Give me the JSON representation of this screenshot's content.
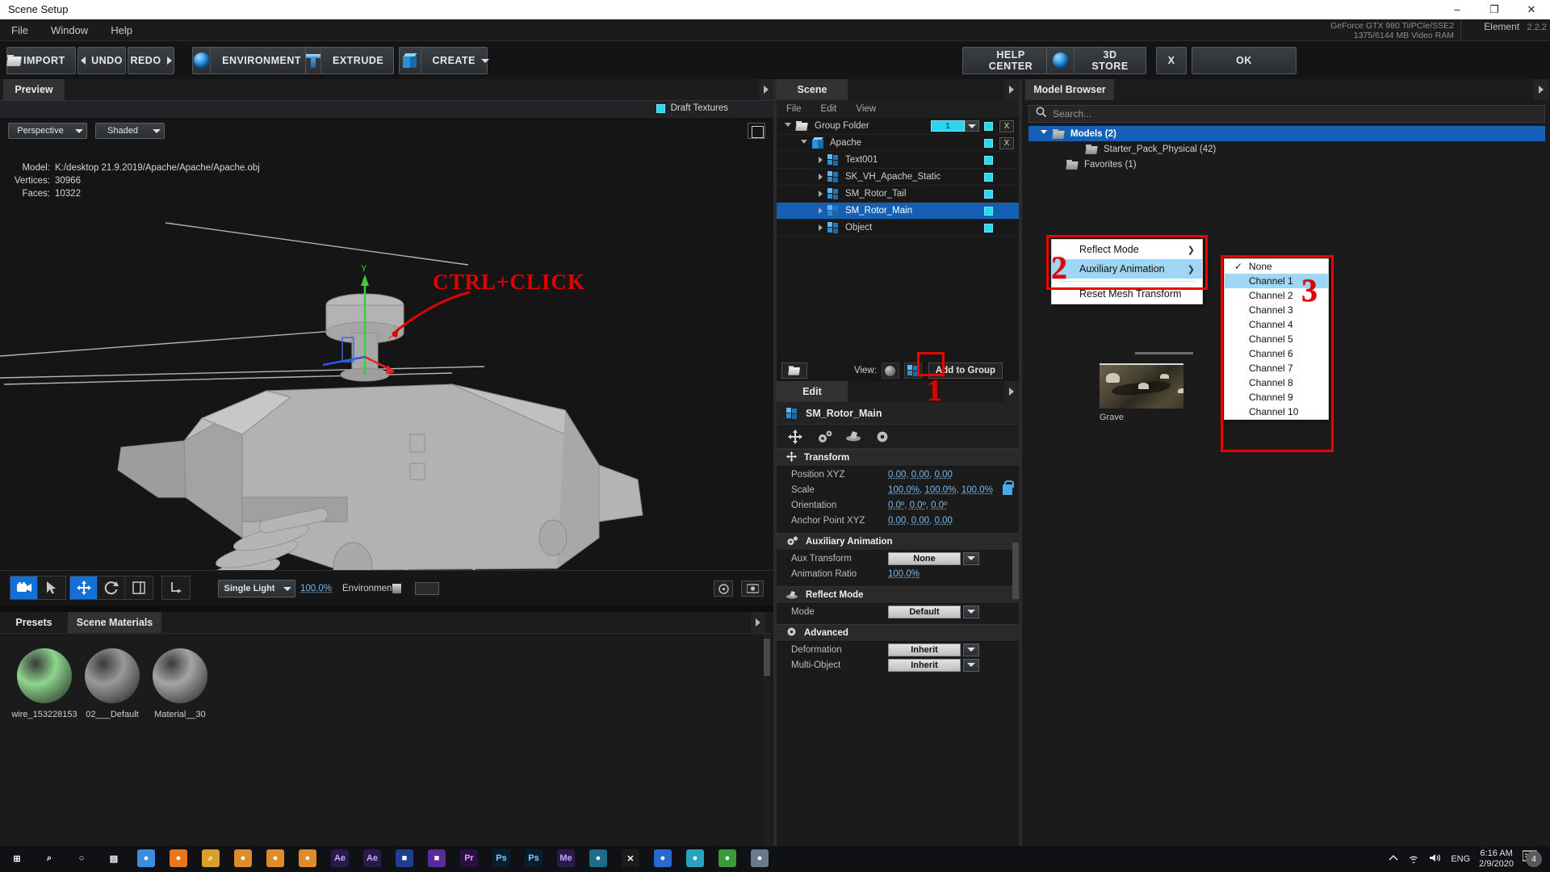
{
  "window": {
    "title": "Scene Setup",
    "minimize": "–",
    "restore": "❐",
    "close": "✕"
  },
  "menubar": {
    "items": [
      "File",
      "Window",
      "Help"
    ]
  },
  "gpu": {
    "line1": "GeForce GTX 980 Ti/PCIe/SSE2",
    "line2": "1375/6144 MB Video RAM"
  },
  "product": {
    "name": "Element",
    "version": "2.2.2"
  },
  "toolbar": {
    "import": "IMPORT",
    "undo": "UNDO",
    "redo": "REDO",
    "environment": "ENVIRONMENT",
    "extrude": "EXTRUDE",
    "create": "CREATE",
    "help_center": "HELP CENTER",
    "store": "3D STORE",
    "cancel": "X",
    "ok": "OK"
  },
  "preview": {
    "tab": "Preview",
    "draft_textures": "Draft Textures",
    "view_mode": "Perspective",
    "shading_mode": "Shaded",
    "info": {
      "model_key": "Model:",
      "model_value": "K:/desktop 21.9.2019/Apache/Apache/Apache.obj",
      "vertices_key": "Vertices:",
      "vertices_value": "30966",
      "faces_key": "Faces:",
      "faces_value": "10322"
    },
    "light_preset": "Single Light",
    "light_value": "100.0%",
    "environment_label": "Environment",
    "annotation": "CTRL+CLICK"
  },
  "materials": {
    "tabs": [
      {
        "label": "Presets",
        "active": false
      },
      {
        "label": "Scene Materials",
        "active": true
      }
    ],
    "items": [
      {
        "name": "wire_153228153",
        "color": "#8ed48e"
      },
      {
        "name": "02___Default",
        "color": "#9a9a9a"
      },
      {
        "name": "Material__30",
        "color": "#a5a5a5"
      }
    ]
  },
  "scene": {
    "tab": "Scene",
    "menu": [
      "File",
      "Edit",
      "View"
    ],
    "rows": [
      {
        "label": "Group Folder",
        "icon": "folder-icon",
        "indent": 10,
        "twirl": "open",
        "chip": "1",
        "has_chip": true,
        "visible": true,
        "xbtn": "X",
        "selected": false
      },
      {
        "label": "Apache",
        "icon": "cube-icon",
        "indent": 30,
        "twirl": "open",
        "has_chip": false,
        "visible": true,
        "xbtn": "X",
        "selected": false
      },
      {
        "label": "Text001",
        "icon": "mesh-icon",
        "indent": 52,
        "twirl": "closed",
        "has_chip": false,
        "visible": true,
        "xbtn": "",
        "selected": false
      },
      {
        "label": "SK_VH_Apache_Static",
        "icon": "mesh-icon",
        "indent": 52,
        "twirl": "closed",
        "has_chip": false,
        "visible": true,
        "xbtn": "",
        "selected": false
      },
      {
        "label": "SM_Rotor_Tail",
        "icon": "mesh-icon",
        "indent": 52,
        "twirl": "closed",
        "has_chip": false,
        "visible": true,
        "xbtn": "",
        "selected": false
      },
      {
        "label": "SM_Rotor_Main",
        "icon": "mesh-icon",
        "indent": 52,
        "twirl": "closed",
        "has_chip": false,
        "visible": true,
        "xbtn": "",
        "selected": true
      },
      {
        "label": "Object",
        "icon": "mesh-icon",
        "indent": 52,
        "twirl": "closed",
        "has_chip": false,
        "visible": true,
        "xbtn": "",
        "selected": false
      }
    ],
    "view_label": "View:",
    "add_to_group": "Add to Group"
  },
  "context_menu": {
    "items": [
      {
        "label": "Reflect Mode",
        "submenu": true,
        "highlighted": false
      },
      {
        "label": "Auxiliary Animation",
        "submenu": true,
        "highlighted": true
      },
      {
        "label": "Reset Mesh Transform",
        "submenu": false,
        "highlighted": false
      }
    ],
    "marker": "2"
  },
  "channel_menu": {
    "items": [
      {
        "label": "None",
        "checked": true,
        "highlighted": false
      },
      {
        "label": "Channel 1",
        "checked": false,
        "highlighted": true
      },
      {
        "label": "Channel 2",
        "checked": false,
        "highlighted": false
      },
      {
        "label": "Channel 3",
        "checked": false,
        "highlighted": false
      },
      {
        "label": "Channel 4",
        "checked": false,
        "highlighted": false
      },
      {
        "label": "Channel 5",
        "checked": false,
        "highlighted": false
      },
      {
        "label": "Channel 6",
        "checked": false,
        "highlighted": false
      },
      {
        "label": "Channel 7",
        "checked": false,
        "highlighted": false
      },
      {
        "label": "Channel 8",
        "checked": false,
        "highlighted": false
      },
      {
        "label": "Channel 9",
        "checked": false,
        "highlighted": false
      },
      {
        "label": "Channel 10",
        "checked": false,
        "highlighted": false
      }
    ],
    "marker": "3"
  },
  "markers": {
    "one": "1"
  },
  "edit": {
    "tab": "Edit",
    "object_name": "SM_Rotor_Main",
    "sections": [
      {
        "title": "Transform",
        "icon": "move-icon",
        "rows": [
          {
            "label": "Position XYZ",
            "type": "numbers",
            "values": [
              "0.00",
              "0.00",
              "0.00"
            ]
          },
          {
            "label": "Scale",
            "type": "numbers",
            "values": [
              "100.0%",
              "100.0%",
              "100.0%"
            ],
            "lock": true
          },
          {
            "label": "Orientation",
            "type": "numbers",
            "values": [
              "0.0º",
              "0.0º",
              "0.0º"
            ]
          },
          {
            "label": "Anchor Point XYZ",
            "type": "numbers",
            "values": [
              "0.00",
              "0.00",
              "0.00"
            ]
          }
        ]
      },
      {
        "title": "Auxiliary Animation",
        "icon": "gears-icon",
        "rows": [
          {
            "label": "Aux Transform",
            "type": "combo",
            "value": "None"
          },
          {
            "label": "Animation Ratio",
            "type": "numbers",
            "values": [
              "100.0%"
            ]
          }
        ]
      },
      {
        "title": "Reflect Mode",
        "icon": "reflect-icon",
        "rows": [
          {
            "label": "Mode",
            "type": "combo",
            "value": "Default"
          }
        ]
      },
      {
        "title": "Advanced",
        "icon": "gear-icon",
        "rows": [
          {
            "label": "Deformation",
            "type": "combo",
            "value": "Inherit"
          },
          {
            "label": "Multi-Object",
            "type": "combo",
            "value": "Inherit"
          }
        ]
      }
    ]
  },
  "model_browser": {
    "tab": "Model Browser",
    "search_placeholder": "Search...",
    "rows": [
      {
        "label": "Models (2)",
        "indent": 8,
        "twirl": "open",
        "selected": true
      },
      {
        "label": "Starter_Pack_Physical (42)",
        "indent": 48,
        "twirl": "none",
        "selected": false
      },
      {
        "label": "Favorites (1)",
        "indent": 24,
        "twirl": "none",
        "selected": false
      }
    ],
    "thumbnail": {
      "name": "Grave"
    }
  },
  "taskbar": {
    "language": "ENG",
    "time": "6:16 AM",
    "date": "2/9/2020",
    "notification_count": "4",
    "apps": [
      {
        "name": "start-button",
        "glyph": "⊞",
        "color": "#ffffff",
        "bg": "transparent"
      },
      {
        "name": "search-button",
        "glyph": "⌕",
        "color": "#ffffff",
        "bg": "transparent"
      },
      {
        "name": "cortana-button",
        "glyph": "○",
        "color": "#ffffff",
        "bg": "transparent"
      },
      {
        "name": "task-view-button",
        "glyph": "▤",
        "color": "#ffffff",
        "bg": "transparent"
      },
      {
        "name": "chrome",
        "glyph": "●",
        "color": "#ffffff",
        "bg": "#3a8de0"
      },
      {
        "name": "firefox",
        "glyph": "●",
        "color": "#ffffff",
        "bg": "#e8761c"
      },
      {
        "name": "search-app",
        "glyph": "⌕",
        "color": "#ffffff",
        "bg": "#d8a02a"
      },
      {
        "name": "blender-1",
        "glyph": "●",
        "color": "#ffffff",
        "bg": "#e08b2a"
      },
      {
        "name": "blender-2",
        "glyph": "●",
        "color": "#ffffff",
        "bg": "#e08b2a"
      },
      {
        "name": "blender-3",
        "glyph": "●",
        "color": "#ffffff",
        "bg": "#e08b2a"
      },
      {
        "name": "after-effects-1",
        "glyph": "Ae",
        "color": "#c7a6ff",
        "bg": "#2a1a4a"
      },
      {
        "name": "after-effects-2",
        "glyph": "Ae",
        "color": "#c7a6ff",
        "bg": "#2a1a4a"
      },
      {
        "name": "app-blue-1",
        "glyph": "■",
        "color": "#ffffff",
        "bg": "#1c3f8f"
      },
      {
        "name": "app-purple",
        "glyph": "■",
        "color": "#ffffff",
        "bg": "#5a2a9a"
      },
      {
        "name": "premiere",
        "glyph": "Pr",
        "color": "#d0a0ff",
        "bg": "#2a1040"
      },
      {
        "name": "photoshop-1",
        "glyph": "Ps",
        "color": "#8cc8ff",
        "bg": "#04202e"
      },
      {
        "name": "photoshop-2",
        "glyph": "Ps",
        "color": "#8cc8ff",
        "bg": "#04202e"
      },
      {
        "name": "media-encoder",
        "glyph": "Me",
        "color": "#c7a6ff",
        "bg": "#2a1a4a"
      },
      {
        "name": "app-teal",
        "glyph": "●",
        "color": "#ffffff",
        "bg": "#1d6a8a"
      },
      {
        "name": "app-x",
        "glyph": "✕",
        "color": "#ffffff",
        "bg": "#1b1b1b"
      },
      {
        "name": "app-blue-2",
        "glyph": "●",
        "color": "#ffffff",
        "bg": "#2a6ad0"
      },
      {
        "name": "app-circle",
        "glyph": "●",
        "color": "#ffffff",
        "bg": "#2aa0c0"
      },
      {
        "name": "app-green",
        "glyph": "●",
        "color": "#ffffff",
        "bg": "#3a9a3a"
      },
      {
        "name": "app-gray",
        "glyph": "●",
        "color": "#ffffff",
        "bg": "#6a7a8a"
      }
    ]
  }
}
